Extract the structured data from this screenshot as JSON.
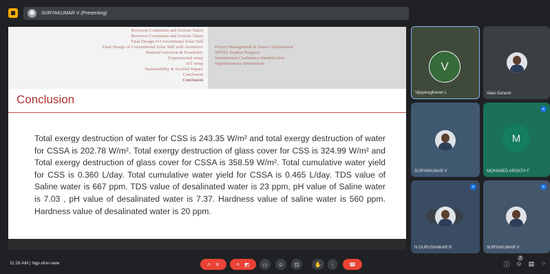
{
  "topbar": {
    "presenter_label": "SURYAKUMAR V (Presenting)"
  },
  "slide": {
    "nav_left": [
      "Reviewer Comments and Actions Taken",
      "Reviewer Comments and Actions Taken",
      "Final Design of Conventional Solar Still",
      "Final Design of Conventional Solar Still with Atomizers",
      "Material Selection & Feasibility",
      "Experimental setup",
      "IoT setup",
      "Sustainability & Societal Impact",
      "Conclusion",
      "Conclusion"
    ],
    "nav_right": [
      "Project Management & Team Collaboration",
      "NPTEL Student Progress",
      "International Conference Identification",
      "Supplementary Information"
    ],
    "title": "Conclusion",
    "body": "Total exergy destruction of water for CSS is 243.35 W/m² and total exergy destruction of water for CSSA is 202.78 W/m². Total exergy destruction of glass cover for CSS is 324.99 W/m² and Total exergy destruction of glass cover for CSSA is 358.59 W/m². Total cumulative water yield for CSS is 0.360 L/day. Total cumulative water yield for CSSA is 0.465 L/day. TDS value of Saline water is 667 ppm. TDS value of desalinated water is 23 ppm, pH value of Saline water is 7.03 , pH value of desalinated water is 7.37. Hardness value of saline water is 560 ppm. Hardness value of desalinated water is 20 ppm."
  },
  "participants": [
    {
      "name": "Vijayaraghavan L",
      "initial": "V"
    },
    {
      "name": "Valai Ganesh"
    },
    {
      "name": "SURYAKUMAR V"
    },
    {
      "name": "MOHAMED ARSATH F",
      "initial": "M"
    },
    {
      "name": "N GURUSANKAR R"
    },
    {
      "name": "SURYAKUMAR V"
    }
  ],
  "bottombar": {
    "time": "11:26 AM",
    "separator": "|",
    "meeting_code": "hqp-sfun-sww",
    "participant_count": "7"
  },
  "colors": {
    "accent_red": "#ea4335",
    "slide_title": "#b0302e",
    "active_speaker_border": "#8ab4f8"
  }
}
